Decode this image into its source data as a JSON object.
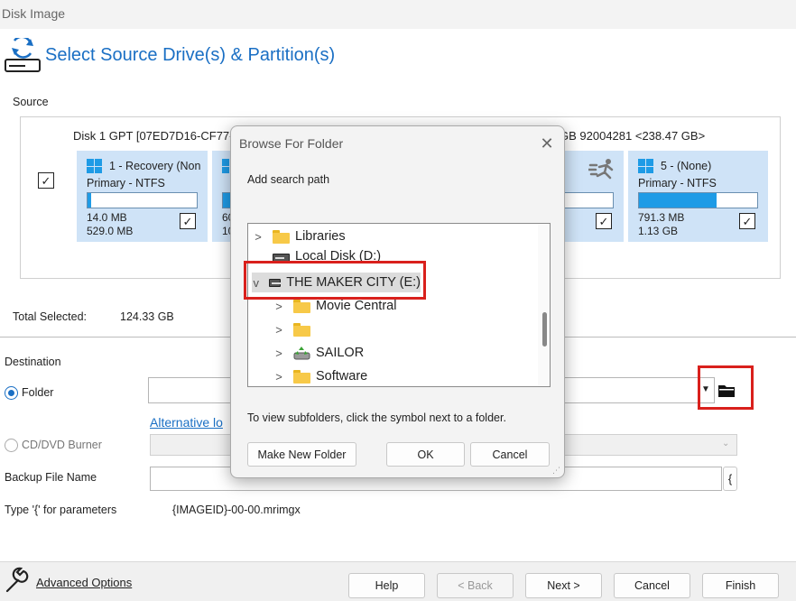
{
  "window": {
    "title": "Disk Image"
  },
  "header": {
    "title": "Select Source Drive(s) & Partition(s)"
  },
  "source": {
    "label": "Source",
    "disk_header_left": "Disk 1 GPT [07ED7D16-CF77-4",
    "disk_header_right": "GB 92004281  <238.47 GB>",
    "partitions": [
      {
        "name": "1 - Recovery (Non",
        "type": "Primary - NTFS",
        "used": "14.0 MB",
        "total": "529.0 MB",
        "fill": 0.03,
        "checked": true
      },
      {
        "name": "",
        "type": "",
        "used": "60",
        "total": "10",
        "fill": 0.5,
        "checked": true
      },
      {
        "name": "",
        "type": "",
        "used": "",
        "total": "",
        "fill": 0,
        "checked": true
      },
      {
        "name": "5 -  (None)",
        "type": "Primary - NTFS",
        "used": "791.3 MB",
        "total": "1.13 GB",
        "fill": 0.7,
        "checked": true
      }
    ]
  },
  "total_selected": {
    "label": "Total Selected:",
    "value": "124.33 GB"
  },
  "destination": {
    "label": "Destination",
    "folder_label": "Folder",
    "alt_location_link": "Alternative lo",
    "cd_label": "CD/DVD Burner"
  },
  "backup_file": {
    "label": "Backup File Name",
    "param_button": "{",
    "param_hint": "Type '{' for parameters",
    "param_value": "{IMAGEID}-00-00.mrimgx"
  },
  "footer": {
    "advanced_options": "Advanced Options",
    "help": "Help",
    "back": "< Back",
    "next": "Next >",
    "cancel": "Cancel",
    "finish": "Finish"
  },
  "dialog": {
    "title": "Browse For Folder",
    "close": "✕",
    "subtitle": "Add search path",
    "tree": [
      {
        "label": "Libraries",
        "icon": "folder-icon",
        "expand": ">"
      },
      {
        "label": "Local Disk (D:)",
        "icon": "drive-icon",
        "expand": ""
      },
      {
        "label": "THE MAKER CITY (E:)",
        "icon": "drive-icon",
        "expand": "v"
      },
      {
        "label": "Movie Central",
        "icon": "folder-icon",
        "expand": ">"
      },
      {
        "label": "",
        "icon": "folder-icon",
        "expand": ">"
      },
      {
        "label": "SAILOR",
        "icon": "recycle-drive-icon",
        "expand": ">"
      },
      {
        "label": "Software",
        "icon": "folder-icon",
        "expand": ">"
      }
    ],
    "hint": "To view subfolders, click the symbol next to a folder.",
    "make_new_folder": "Make New Folder",
    "ok": "OK",
    "cancel": "Cancel"
  },
  "colors": {
    "accent": "#1a6fc4",
    "partition_bg": "#cfe3f7",
    "highlight": "#d9201c"
  }
}
